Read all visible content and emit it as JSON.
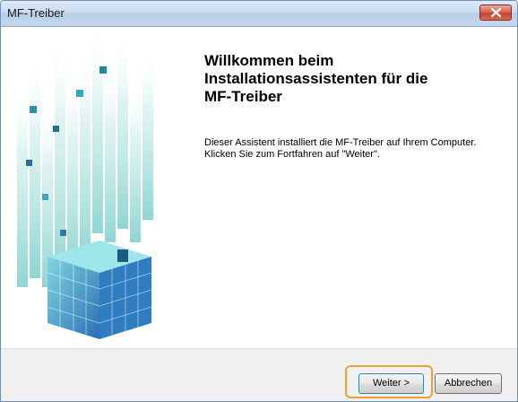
{
  "window": {
    "title": "MF-Treiber"
  },
  "content": {
    "heading": "Willkommen beim\nInstallationsassistenten für die\nMF-Treiber",
    "body": "Dieser Assistent installiert die MF-Treiber auf Ihrem Computer.\nKlicken Sie zum Fortfahren auf \"Weiter\"."
  },
  "buttons": {
    "next_label": "Weiter >",
    "cancel_label": "Abbrechen"
  },
  "colors": {
    "highlight": "#f0a030",
    "art_cyan": "#3fb6c9",
    "art_blue": "#2a5fa8"
  },
  "icons": {
    "close": "close-icon",
    "side_art": "cube-graphic"
  }
}
